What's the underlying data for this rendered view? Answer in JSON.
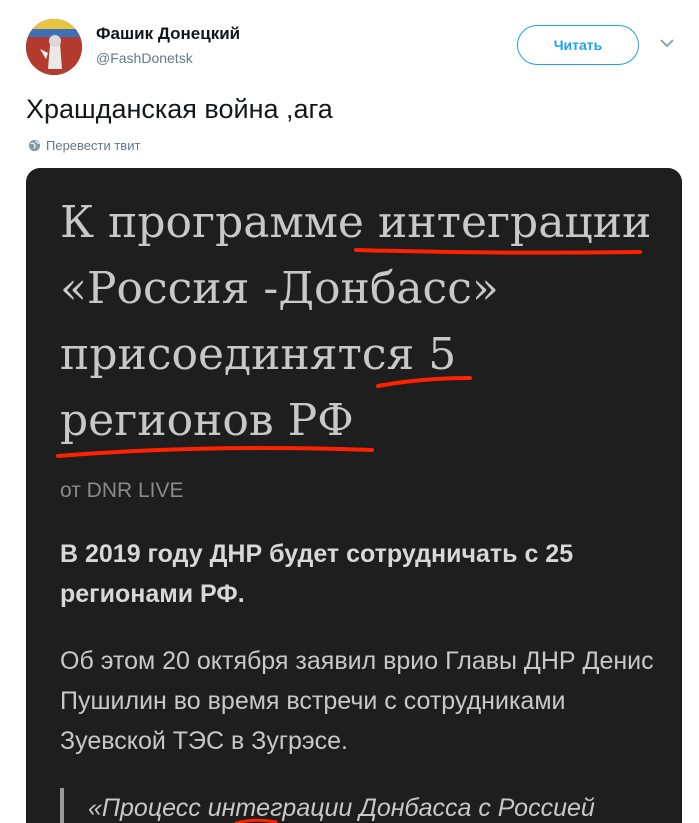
{
  "author": {
    "name": "Фашик Донецкий",
    "handle": "@FashDonetsk",
    "follow_label": "Читать"
  },
  "tweet": {
    "text": "Храшданская война ,ага",
    "translate_label": "Перевести твит"
  },
  "media": {
    "headline_lines": [
      "К программе интеграции",
      "«Россия -Донбасс»",
      "присоединятся 5",
      "регионов РФ"
    ],
    "source": "от DNR LIVE",
    "lead": "В 2019 году ДНР будет сотрудничать с 25 регионами РФ.",
    "paragraph": "Об этом 20 октября заявил врио Главы ДНР Денис Пушилин во время встречи с сотрудниками Зуевской ТЭС в Зугрэсе.",
    "quote": "«Процесс интеграции Донбасса с Россией",
    "annotation_color": "#ff2200"
  },
  "icons": {
    "caret": "chevron-down-icon",
    "globe": "globe-icon"
  }
}
